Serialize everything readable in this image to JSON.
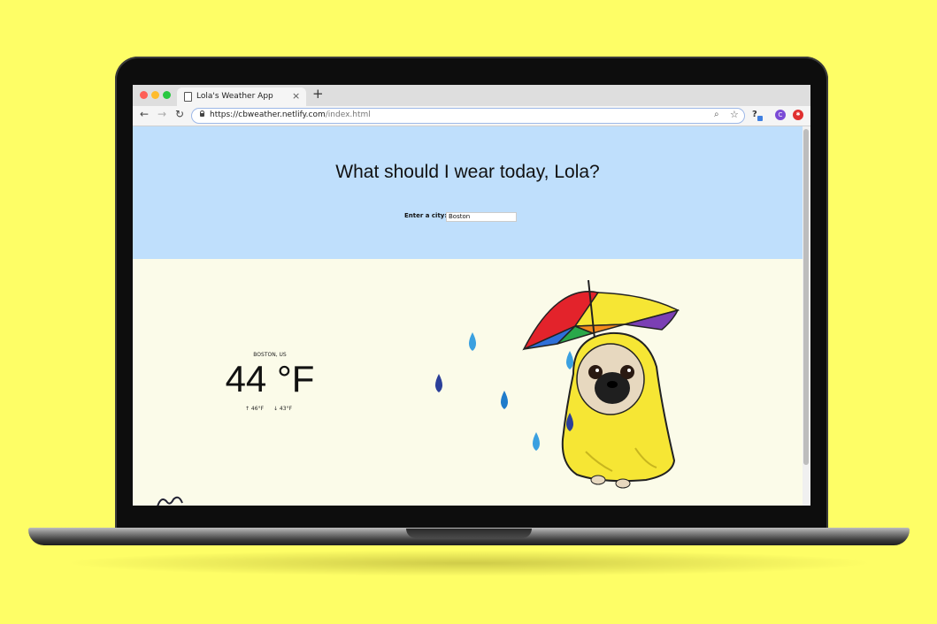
{
  "browser": {
    "tab_title": "Lola's Weather App",
    "tab_close": "×",
    "new_tab": "+",
    "url_host": "https://cbweather.netlify.com",
    "url_path": "/index.html",
    "avatar_letter": "C"
  },
  "hero": {
    "headline": "What should I wear today, Lola?",
    "city_label": "Enter a city:",
    "city_value": "Boston"
  },
  "weather": {
    "location": "BOSTON, US",
    "temperature": "44 °F",
    "high": "↑ 46°F",
    "low": "↓ 43°F"
  },
  "colors": {
    "background": "#fefe66",
    "hero": "#bfdffc",
    "page": "#fbfbe9",
    "raincoat": "#f6e634",
    "raindrop_light": "#3aa0e0",
    "raindrop_dark": "#2b3f99"
  }
}
